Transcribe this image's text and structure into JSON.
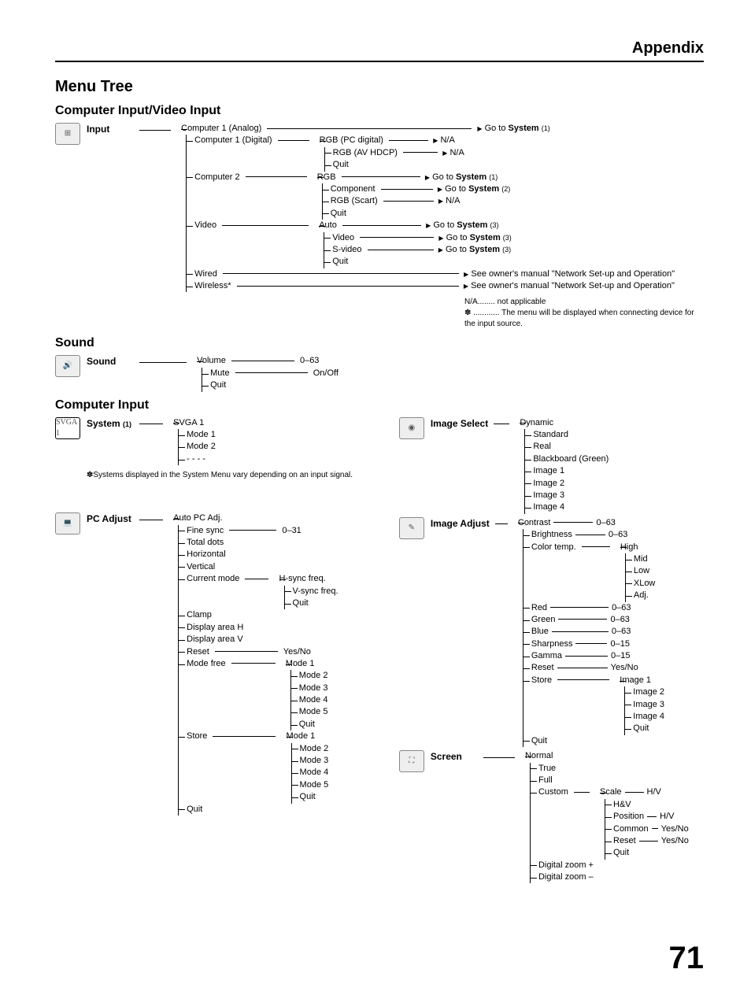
{
  "header": "Appendix",
  "title": "Menu Tree",
  "section1_title": "Computer Input/Video Input",
  "input": {
    "root": "Input",
    "computer1_analog": "Computer 1 (Analog)",
    "computer1_analog_dest": "Go to System (1)",
    "computer1_digital": "Computer 1 (Digital)",
    "c1d_rgb_pc": "RGB (PC digital)",
    "c1d_rgb_pc_dest": "N/A",
    "c1d_rgb_av": "RGB (AV HDCP)",
    "c1d_rgb_av_dest": "N/A",
    "c1d_quit": "Quit",
    "computer2": "Computer 2",
    "c2_rgb": "RGB",
    "c2_rgb_dest": "Go to System (1)",
    "c2_component": "Component",
    "c2_component_dest": "Go to System (2)",
    "c2_rgb_scart": "RGB (Scart)",
    "c2_rgb_scart_dest": "N/A",
    "c2_quit": "Quit",
    "video": "Video",
    "v_auto": "Auto",
    "v_auto_dest": "Go to System (3)",
    "v_video": "Video",
    "v_video_dest": "Go to System (3)",
    "v_svideo": "S-video",
    "v_svideo_dest": "Go to System (3)",
    "v_quit": "Quit",
    "wired": "Wired",
    "wired_dest": "See owner's manual \"Network Set-up and Operation\"",
    "wireless": "Wireless*",
    "wireless_dest": "See owner's manual \"Network Set-up and Operation\"",
    "note_na": "N/A........ not applicable",
    "note_star": "✽ ............ The menu will be displayed when connecting device for the input source."
  },
  "sound_section": {
    "title": "Sound",
    "root": "Sound",
    "volume": "Volume",
    "volume_range": "0–63",
    "mute": "Mute",
    "mute_opts": "On/Off",
    "quit": "Quit"
  },
  "computer_input": {
    "title": "Computer Input",
    "system_label": "System",
    "system_ref": "(1)",
    "svga1_badge": "SVGA 1",
    "sys_items": [
      "SVGA 1",
      "Mode 1",
      "Mode 2",
      "- - - -"
    ],
    "sys_note": "✽Systems displayed in the System Menu vary depending on an input signal.",
    "pc_adjust": {
      "root": "PC Adjust",
      "auto_pc": "Auto PC Adj.",
      "fine_sync": "Fine sync",
      "fine_sync_range": "0–31",
      "total_dots": "Total dots",
      "horizontal": "Horizontal",
      "vertical": "Vertical",
      "current_mode": "Current mode",
      "cm_h": "H-sync freq.",
      "cm_v": "V-sync freq.",
      "cm_quit": "Quit",
      "clamp": "Clamp",
      "display_h": "Display area H",
      "display_v": "Display area V",
      "reset": "Reset",
      "reset_opts": "Yes/No",
      "mode_free": "Mode free",
      "mf_items": [
        "Mode 1",
        "Mode 2",
        "Mode 3",
        "Mode 4",
        "Mode 5",
        "Quit"
      ],
      "store": "Store",
      "st_items": [
        "Mode 1",
        "Mode 2",
        "Mode 3",
        "Mode 4",
        "Mode 5",
        "Quit"
      ],
      "quit": "Quit"
    },
    "image_select": {
      "root": "Image Select",
      "items": [
        "Dynamic",
        "Standard",
        "Real",
        "Blackboard (Green)",
        "Image 1",
        "Image 2",
        "Image 3",
        "Image 4"
      ]
    },
    "image_adjust": {
      "root": "Image Adjust",
      "contrast": "Contrast",
      "contrast_r": "0–63",
      "brightness": "Brightness",
      "brightness_r": "0–63",
      "color_temp": "Color temp.",
      "ct_items": [
        "High",
        "Mid",
        "Low",
        "XLow",
        "Adj."
      ],
      "red": "Red",
      "red_r": "0–63",
      "green": "Green",
      "green_r": "0–63",
      "blue": "Blue",
      "blue_r": "0–63",
      "sharpness": "Sharpness",
      "sharpness_r": "0–15",
      "gamma": "Gamma",
      "gamma_r": "0–15",
      "reset": "Reset",
      "reset_r": "Yes/No",
      "store": "Store",
      "store_items": [
        "Image 1",
        "Image 2",
        "Image 3",
        "Image 4",
        "Quit"
      ],
      "quit": "Quit"
    },
    "screen": {
      "root": "Screen",
      "normal": "Normal",
      "true": "True",
      "full": "Full",
      "custom": "Custom",
      "c_scale": "Scale",
      "c_scale_r": "H/V",
      "c_hv": "H&V",
      "c_position": "Position",
      "c_position_r": "H/V",
      "c_common": "Common",
      "c_common_r": "Yes/No",
      "c_reset": "Reset",
      "c_reset_r": "Yes/No",
      "c_quit": "Quit",
      "dzoom_p": "Digital zoom +",
      "dzoom_m": "Digital zoom –"
    }
  },
  "page_number": "71"
}
